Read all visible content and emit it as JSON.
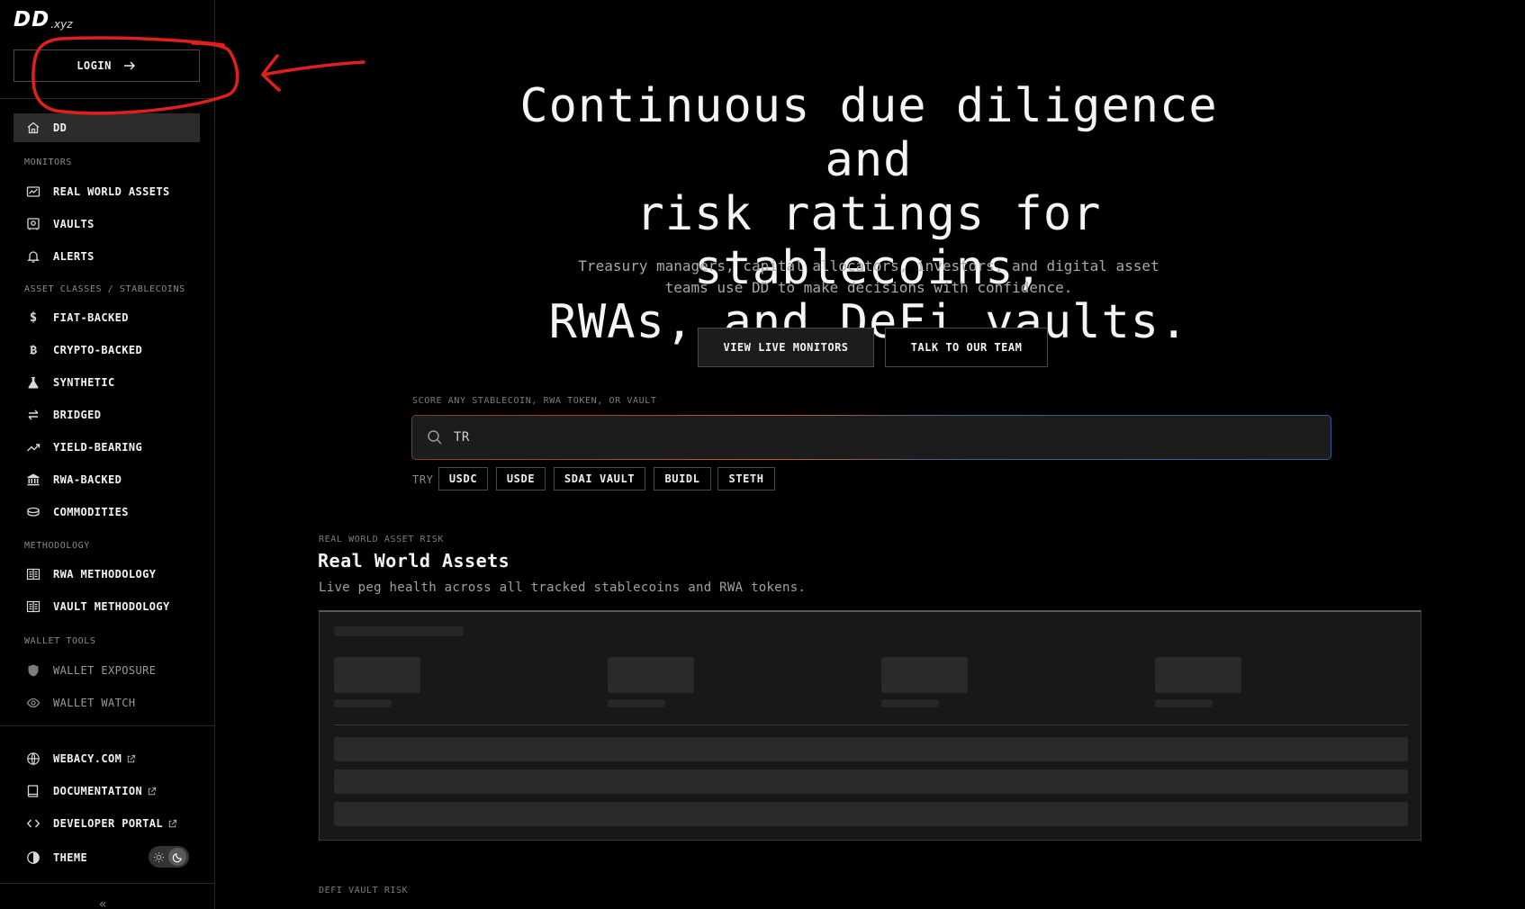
{
  "brand": {
    "logo": "DD",
    "tld": ".xyz"
  },
  "sidebar": {
    "login_label": "LOGIN",
    "home": {
      "label": "DD",
      "icon": "home-icon"
    },
    "sections": {
      "monitors": "MONITORS",
      "asset_classes": "ASSET CLASSES / STABLECOINS",
      "methodology": "METHODOLOGY",
      "wallet_tools": "WALLET TOOLS"
    },
    "monitors": [
      {
        "label": "REAL WORLD ASSETS",
        "icon": "chart-card-icon"
      },
      {
        "label": "VAULTS",
        "icon": "vault-icon"
      },
      {
        "label": "ALERTS",
        "icon": "bell-icon"
      }
    ],
    "asset_classes": [
      {
        "label": "FIAT-BACKED",
        "icon": "dollar-icon"
      },
      {
        "label": "CRYPTO-BACKED",
        "icon": "bitcoin-icon"
      },
      {
        "label": "SYNTHETIC",
        "icon": "flask-icon"
      },
      {
        "label": "BRIDGED",
        "icon": "swap-arrows-icon"
      },
      {
        "label": "YIELD-BEARING",
        "icon": "trend-up-icon"
      },
      {
        "label": "RWA-BACKED",
        "icon": "bank-icon"
      },
      {
        "label": "COMMODITIES",
        "icon": "coins-icon"
      }
    ],
    "methodology": [
      {
        "label": "RWA METHODOLOGY",
        "icon": "document-icon"
      },
      {
        "label": "VAULT METHODOLOGY",
        "icon": "document-icon"
      }
    ],
    "wallet_tools": [
      {
        "label": "WALLET EXPOSURE",
        "icon": "shield-icon"
      },
      {
        "label": "WALLET WATCH",
        "icon": "eye-icon"
      }
    ],
    "footer": [
      {
        "label": "WEBACY.COM",
        "icon": "globe-icon",
        "external": true
      },
      {
        "label": "DOCUMENTATION",
        "icon": "book-icon",
        "external": true
      },
      {
        "label": "DEVELOPER PORTAL",
        "icon": "code-icon",
        "external": true
      }
    ],
    "theme_label": "THEME",
    "collapse_glyph": "«"
  },
  "hero": {
    "title_line1": "Continuous due diligence and",
    "title_line2": "risk ratings for stablecoins,",
    "title_line3": "RWAs, and DeFi vaults.",
    "subtitle_line1": "Treasury managers, capital allocators, investors, and digital asset",
    "subtitle_line2": "teams use DD to make decisions with confidence.",
    "cta_primary": "VIEW LIVE MONITORS",
    "cta_secondary": "TALK TO OUR TEAM"
  },
  "search": {
    "label": "SCORE ANY STABLECOIN, RWA TOKEN, OR VAULT",
    "value": "TR",
    "try_label": "TRY",
    "suggestions": [
      "USDC",
      "USDE",
      "SDAI VAULT",
      "BUIDL",
      "STETH"
    ]
  },
  "rwa_section": {
    "kicker": "REAL WORLD ASSET RISK",
    "title": "Real World Assets",
    "subtitle": "Live peg health across all tracked stablecoins and RWA tokens."
  },
  "vault_section": {
    "kicker": "DEFI VAULT RISK"
  },
  "colors": {
    "background": "#000000",
    "annotation": "#e0201b",
    "search_gradient_left": "#c05a2a",
    "search_gradient_right": "#2a5d9e"
  }
}
